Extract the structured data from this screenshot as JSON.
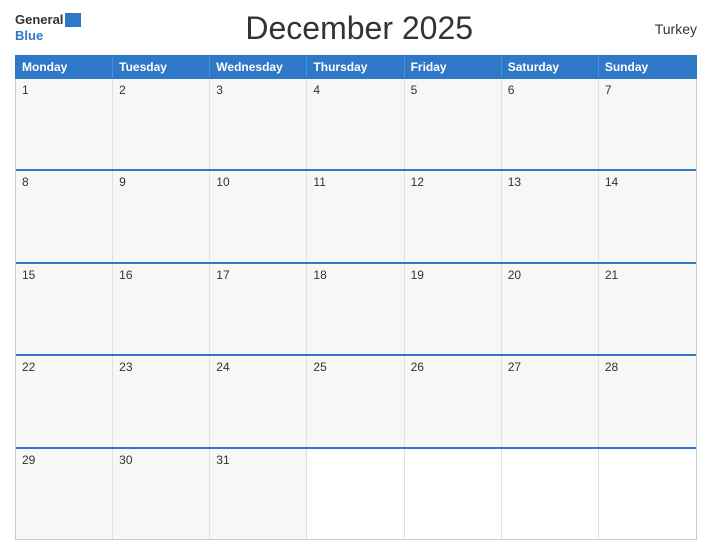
{
  "header": {
    "logo_general": "General",
    "logo_blue": "Blue",
    "title": "December 2025",
    "country": "Turkey"
  },
  "days_of_week": [
    "Monday",
    "Tuesday",
    "Wednesday",
    "Thursday",
    "Friday",
    "Saturday",
    "Sunday"
  ],
  "weeks": [
    [
      {
        "day": 1
      },
      {
        "day": 2
      },
      {
        "day": 3
      },
      {
        "day": 4
      },
      {
        "day": 5
      },
      {
        "day": 6
      },
      {
        "day": 7
      }
    ],
    [
      {
        "day": 8
      },
      {
        "day": 9
      },
      {
        "day": 10
      },
      {
        "day": 11
      },
      {
        "day": 12
      },
      {
        "day": 13
      },
      {
        "day": 14
      }
    ],
    [
      {
        "day": 15
      },
      {
        "day": 16
      },
      {
        "day": 17
      },
      {
        "day": 18
      },
      {
        "day": 19
      },
      {
        "day": 20
      },
      {
        "day": 21
      }
    ],
    [
      {
        "day": 22
      },
      {
        "day": 23
      },
      {
        "day": 24
      },
      {
        "day": 25
      },
      {
        "day": 26
      },
      {
        "day": 27
      },
      {
        "day": 28
      }
    ],
    [
      {
        "day": 29
      },
      {
        "day": 30
      },
      {
        "day": 31
      },
      {
        "day": null
      },
      {
        "day": null
      },
      {
        "day": null
      },
      {
        "day": null
      }
    ]
  ]
}
